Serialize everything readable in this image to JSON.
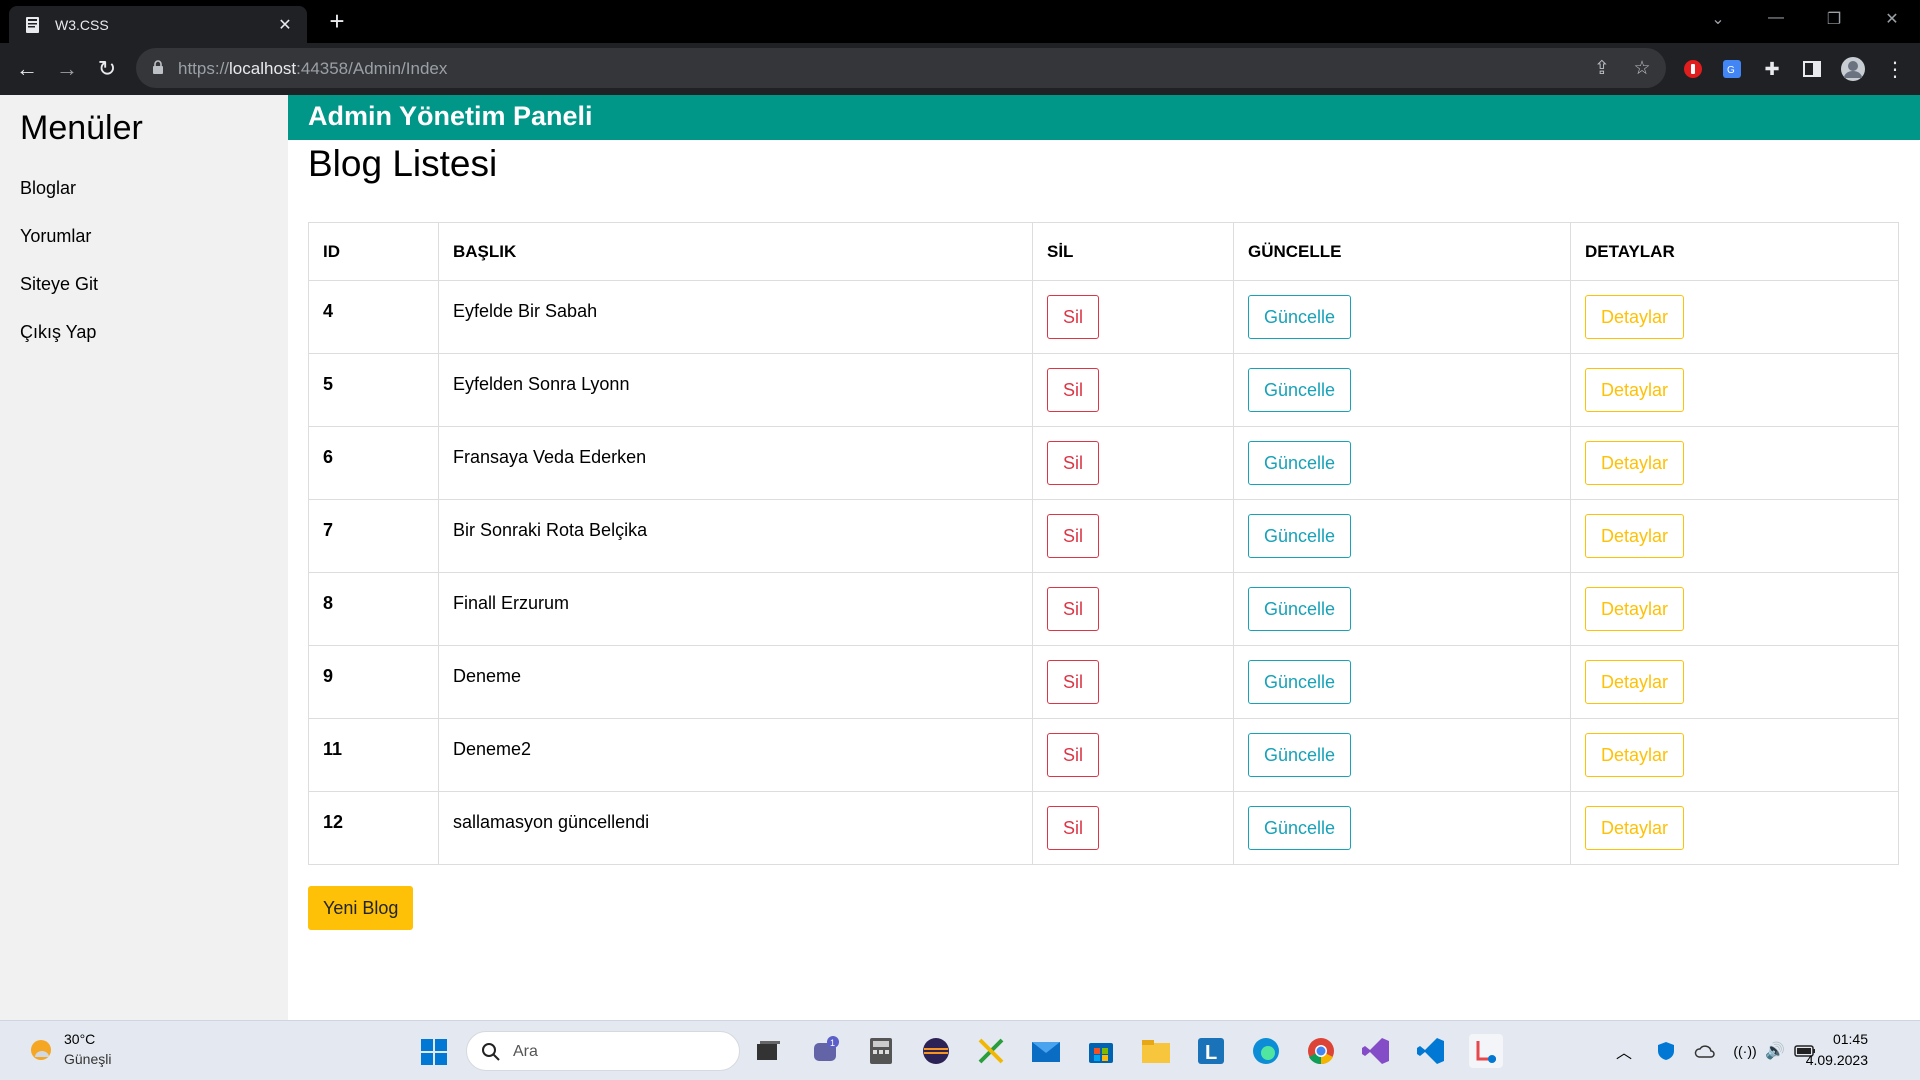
{
  "browser": {
    "tab_title": "W3.CSS",
    "url_prefix": "https://",
    "url_host": "localhost",
    "url_path": ":44358/Admin/Index"
  },
  "sidebar": {
    "title": "Menüler",
    "items": [
      {
        "label": "Bloglar"
      },
      {
        "label": "Yorumlar"
      },
      {
        "label": "Siteye Git"
      },
      {
        "label": "Çıkış Yap"
      }
    ]
  },
  "header": {
    "title": "Admin Yönetim Paneli"
  },
  "main": {
    "page_title": "Blog Listesi",
    "table": {
      "headers": [
        "ID",
        "BAŞLIK",
        "SİL",
        "GÜNCELLE",
        "DETAYLAR"
      ],
      "delete_label": "Sil",
      "update_label": "Güncelle",
      "details_label": "Detaylar",
      "rows": [
        {
          "id": "4",
          "title": "Eyfelde Bir Sabah"
        },
        {
          "id": "5",
          "title": "Eyfelden Sonra Lyonn"
        },
        {
          "id": "6",
          "title": "Fransaya Veda Ederken"
        },
        {
          "id": "7",
          "title": "Bir Sonraki Rota Belçika"
        },
        {
          "id": "8",
          "title": "Finall Erzurum"
        },
        {
          "id": "9",
          "title": "Deneme"
        },
        {
          "id": "11",
          "title": "Deneme2"
        },
        {
          "id": "12",
          "title": "sallamasyon güncellendi"
        }
      ]
    },
    "new_blog_label": "Yeni Blog"
  },
  "colors": {
    "header_teal": "#009688",
    "delete_red": "#dc3545",
    "update_teal": "#17a2b8",
    "details_amber": "#ffc107",
    "sidebar_bg": "#f1f1f1"
  },
  "taskbar": {
    "weather_temp": "30°C",
    "weather_cond": "Güneşli",
    "search_placeholder": "Ara",
    "time": "01:45",
    "date": "4.09.2023",
    "chat_badge": "1"
  }
}
